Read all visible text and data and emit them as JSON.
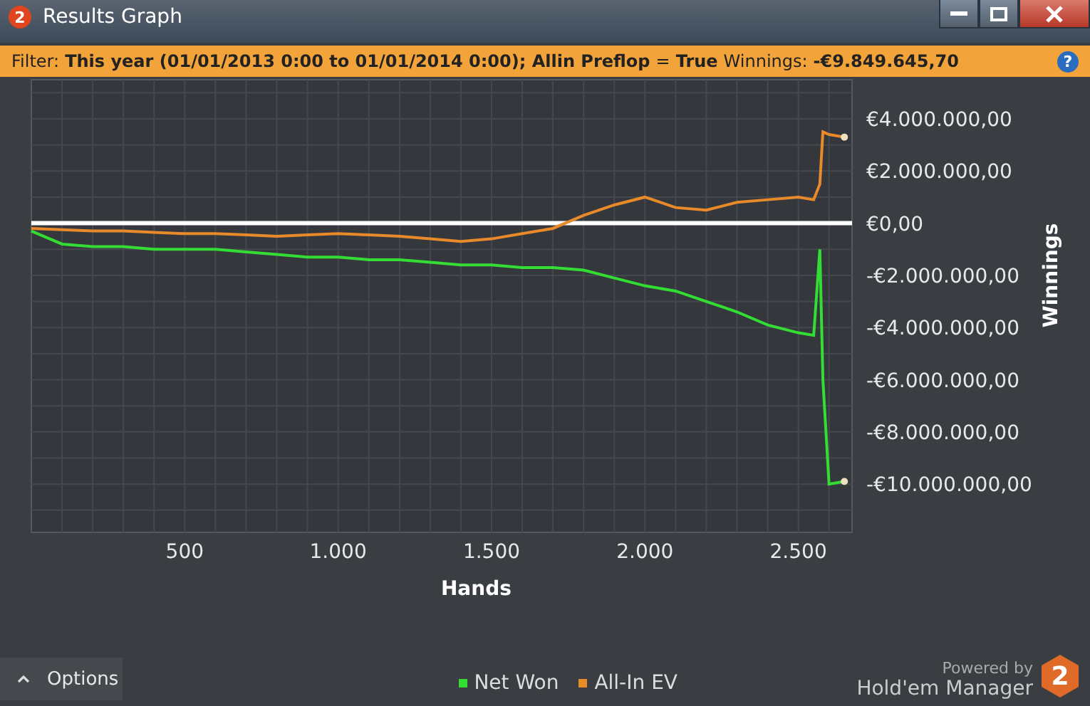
{
  "window": {
    "title": "Results Graph",
    "app_icon_text": "2"
  },
  "filter_bar": {
    "label": "Filter:",
    "filter": "This year (01/01/2013 0:00 to 01/01/2014 0:00); Allin Preflop",
    "operator": "=",
    "value": "True",
    "winnings_label": "Winnings:",
    "winnings": "-€9.849.645,70",
    "help": "?"
  },
  "chart": {
    "chart_data": {
      "type": "line",
      "grid": true,
      "xlabel": "Hands",
      "ylabel": "Winnings",
      "xlim": [
        0,
        2675
      ],
      "ylim": [
        -11850000,
        5500000
      ],
      "xticks": [
        {
          "value": 500,
          "label": "500"
        },
        {
          "value": 1000,
          "label": "1.000"
        },
        {
          "value": 1500,
          "label": "1.500"
        },
        {
          "value": 2000,
          "label": "2.000"
        },
        {
          "value": 2500,
          "label": "2.500"
        }
      ],
      "yticks": [
        {
          "value": 4000000,
          "label": "€4.000.000,00"
        },
        {
          "value": 2000000,
          "label": "€2.000.000,00"
        },
        {
          "value": 0,
          "label": "€0,00"
        },
        {
          "value": -2000000,
          "label": "-€2.000.000,00"
        },
        {
          "value": -4000000,
          "label": "-€4.000.000,00"
        },
        {
          "value": -6000000,
          "label": "-€6.000.000,00"
        },
        {
          "value": -8000000,
          "label": "-€8.000.000,00"
        },
        {
          "value": -10000000,
          "label": "-€10.000.000,00"
        }
      ],
      "x": [
        0,
        100,
        200,
        300,
        400,
        500,
        600,
        700,
        800,
        900,
        1000,
        1100,
        1200,
        1300,
        1400,
        1500,
        1600,
        1700,
        1800,
        1900,
        2000,
        2100,
        2200,
        2300,
        2400,
        2500,
        2550,
        2570,
        2580,
        2600,
        2650
      ],
      "series": [
        {
          "name": "Net Won",
          "color": "#33dd33",
          "values": [
            -300000,
            -800000,
            -900000,
            -900000,
            -1000000,
            -1000000,
            -1000000,
            -1100000,
            -1200000,
            -1300000,
            -1300000,
            -1400000,
            -1400000,
            -1500000,
            -1600000,
            -1600000,
            -1700000,
            -1700000,
            -1800000,
            -2100000,
            -2400000,
            -2600000,
            -3000000,
            -3400000,
            -3900000,
            -4200000,
            -4300000,
            -1000000,
            -6000000,
            -10000000,
            -9900000
          ]
        },
        {
          "name": "All-In EV",
          "color": "#e8892a",
          "values": [
            -200000,
            -250000,
            -300000,
            -300000,
            -350000,
            -400000,
            -400000,
            -450000,
            -500000,
            -450000,
            -400000,
            -450000,
            -500000,
            -600000,
            -700000,
            -600000,
            -400000,
            -200000,
            300000,
            700000,
            1000000,
            600000,
            500000,
            800000,
            900000,
            1000000,
            900000,
            1500000,
            3500000,
            3400000,
            3300000
          ]
        }
      ]
    }
  },
  "footer": {
    "options_button": "Options",
    "powered_by": "Powered by",
    "brand": "Hold'em Manager",
    "logo_text": "2"
  }
}
